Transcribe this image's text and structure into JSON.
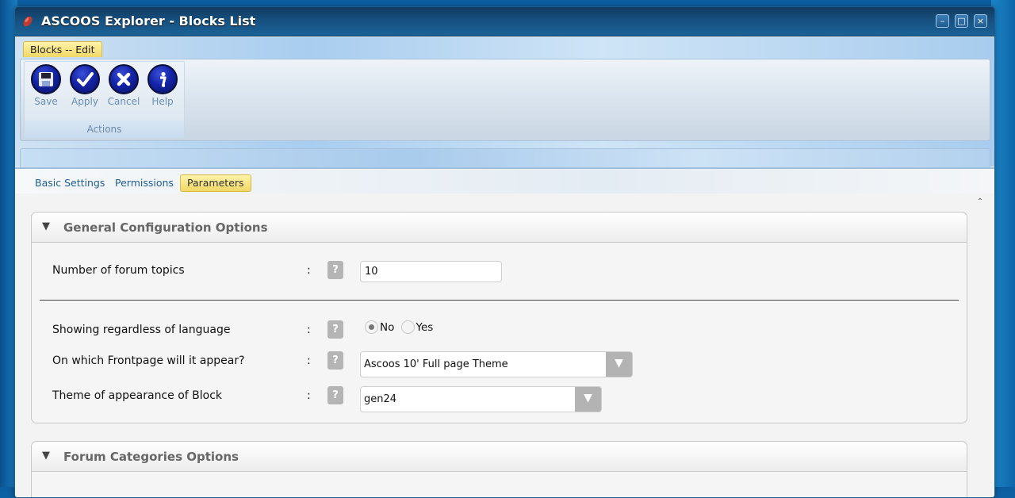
{
  "window": {
    "title": "ASCOOS Explorer - Blocks List",
    "controls": {
      "minimize": "–",
      "maximize": "□",
      "close": "×"
    }
  },
  "ribbon": {
    "tab_label": "Blocks -- Edit",
    "group_label": "Actions",
    "buttons": [
      {
        "label": "Save",
        "icon": "save-icon"
      },
      {
        "label": "Apply",
        "icon": "check-icon"
      },
      {
        "label": "Cancel",
        "icon": "x-icon"
      },
      {
        "label": "Help",
        "icon": "info-icon"
      }
    ]
  },
  "tabs": [
    {
      "label": "Basic Settings",
      "active": false
    },
    {
      "label": "Permissions",
      "active": false
    },
    {
      "label": "Parameters",
      "active": true
    }
  ],
  "sections": {
    "general": {
      "title": "General Configuration Options",
      "fields": {
        "forum_topics": {
          "label": "Number of forum topics",
          "value": "10"
        },
        "language": {
          "label": "Showing regardless of language",
          "options": [
            "No",
            "Yes"
          ],
          "selected": "No"
        },
        "frontpage": {
          "label": "On which Frontpage will it appear?",
          "value": "Ascoos 10' Full page Theme"
        },
        "theme": {
          "label": "Theme of appearance of Block",
          "value": "gen24"
        }
      }
    },
    "forum_categories": {
      "title": "Forum Categories Options"
    }
  },
  "common": {
    "colon": ":",
    "help_glyph": "?",
    "collapse_glyph": "▼",
    "select_glyph": "▼",
    "scroll_up_glyph": "⌃"
  }
}
